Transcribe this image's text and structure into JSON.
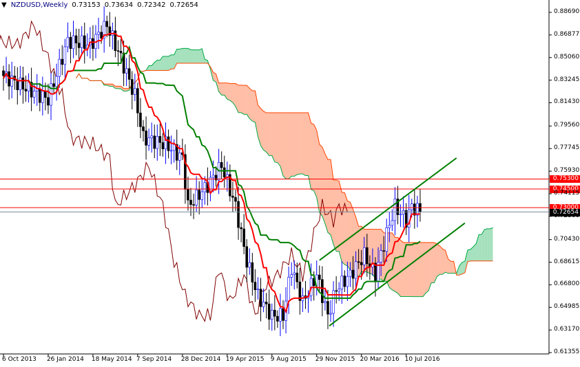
{
  "header": {
    "symbol": "NZDUSD,Weekly",
    "open": "0.73153",
    "high": "0.73634",
    "low": "0.72342",
    "close": "0.72654"
  },
  "price_axis": {
    "max": 0.8869,
    "min": 0.61355,
    "labels": [
      "0.88690",
      "0.86877",
      "0.85060",
      "0.83245",
      "0.81430",
      "0.79560",
      "0.77745",
      "0.75930",
      "0.74115",
      "0.72300",
      "0.70430",
      "0.68615",
      "0.66800",
      "0.64985",
      "0.63170",
      "0.61355"
    ]
  },
  "time_axis": {
    "labels": [
      {
        "text": "6 Oct 2013",
        "week": 0
      },
      {
        "text": "26 Jan 2014",
        "week": 16
      },
      {
        "text": "18 May 2014",
        "week": 32
      },
      {
        "text": "7 Sep 2014",
        "week": 48
      },
      {
        "text": "28 Dec 2014",
        "week": 64
      },
      {
        "text": "19 Apr 2015",
        "week": 80
      },
      {
        "text": "9 Aug 2015",
        "week": 96
      },
      {
        "text": "29 Nov 2015",
        "week": 112
      },
      {
        "text": "20 Mar 2016",
        "week": 128
      },
      {
        "text": "10 Jul 2016",
        "week": 144
      }
    ]
  },
  "levels": [
    {
      "label": "0.75300",
      "price": 0.753
    },
    {
      "label": "0.74500",
      "price": 0.745
    },
    {
      "label": "0.73000",
      "price": 0.73
    }
  ],
  "current": {
    "label": "0.72654",
    "price": 0.72654
  },
  "channel": [
    {
      "w1": 113,
      "p1": 0.6877,
      "w2": 162,
      "p2": 0.7699
    },
    {
      "w1": 116.5,
      "p1": 0.635,
      "w2": 165,
      "p2": 0.7176
    }
  ],
  "close_anchors": [
    [
      0,
      0.836
    ],
    [
      9,
      0.825
    ],
    [
      16,
      0.817
    ],
    [
      23,
      0.864
    ],
    [
      31,
      0.861
    ],
    [
      37,
      0.877
    ],
    [
      42,
      0.85
    ],
    [
      47,
      0.82
    ],
    [
      50,
      0.786
    ],
    [
      58,
      0.781
    ],
    [
      64,
      0.77
    ],
    [
      66,
      0.731
    ],
    [
      73,
      0.748
    ],
    [
      78,
      0.764
    ],
    [
      83,
      0.731
    ],
    [
      87,
      0.687
    ],
    [
      91,
      0.659
    ],
    [
      96,
      0.643
    ],
    [
      100,
      0.643
    ],
    [
      103,
      0.682
    ],
    [
      107,
      0.654
    ],
    [
      112,
      0.676
    ],
    [
      116,
      0.643
    ],
    [
      119,
      0.665
    ],
    [
      124,
      0.676
    ],
    [
      129,
      0.692
    ],
    [
      133,
      0.676
    ],
    [
      137,
      0.709
    ],
    [
      140,
      0.731
    ],
    [
      144,
      0.72
    ],
    [
      146,
      0.731
    ],
    [
      149,
      0.7265
    ]
  ],
  "colors": {
    "bull": "#0000ff",
    "bear": "#000000",
    "tenkan": "#ff0000",
    "kijun": "#008000",
    "chikou": "#800000",
    "cloud_up": "#00aa44",
    "cloud_down": "#ff4500",
    "level": "#ff0000"
  }
}
